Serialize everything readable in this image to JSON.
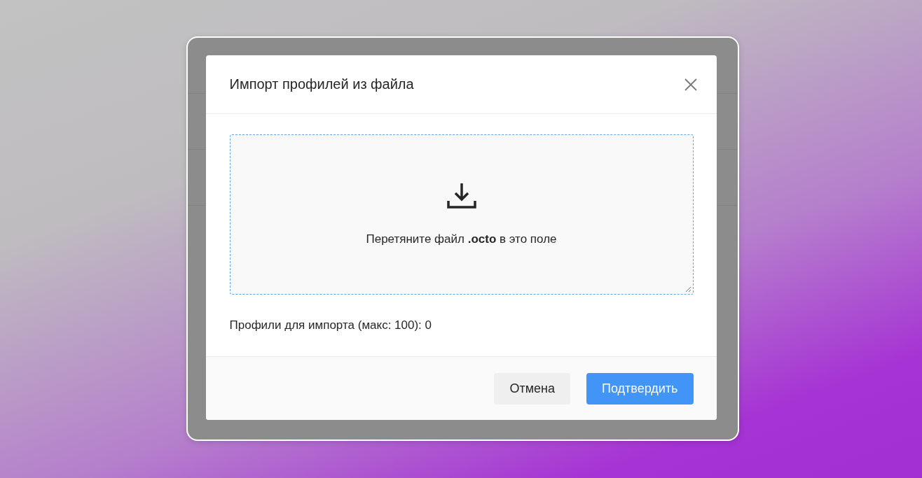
{
  "dialog": {
    "title": "Импорт профилей из файла",
    "dropzone": {
      "text": "Перетяните файл **.octo** в это поле"
    },
    "count_text": "Профили для импорта (макс: 100): 0",
    "buttons": [
      {
        "label": "Отмена",
        "kind": "secondary"
      },
      {
        "label": "Подтвердить",
        "kind": "primary"
      }
    ]
  }
}
